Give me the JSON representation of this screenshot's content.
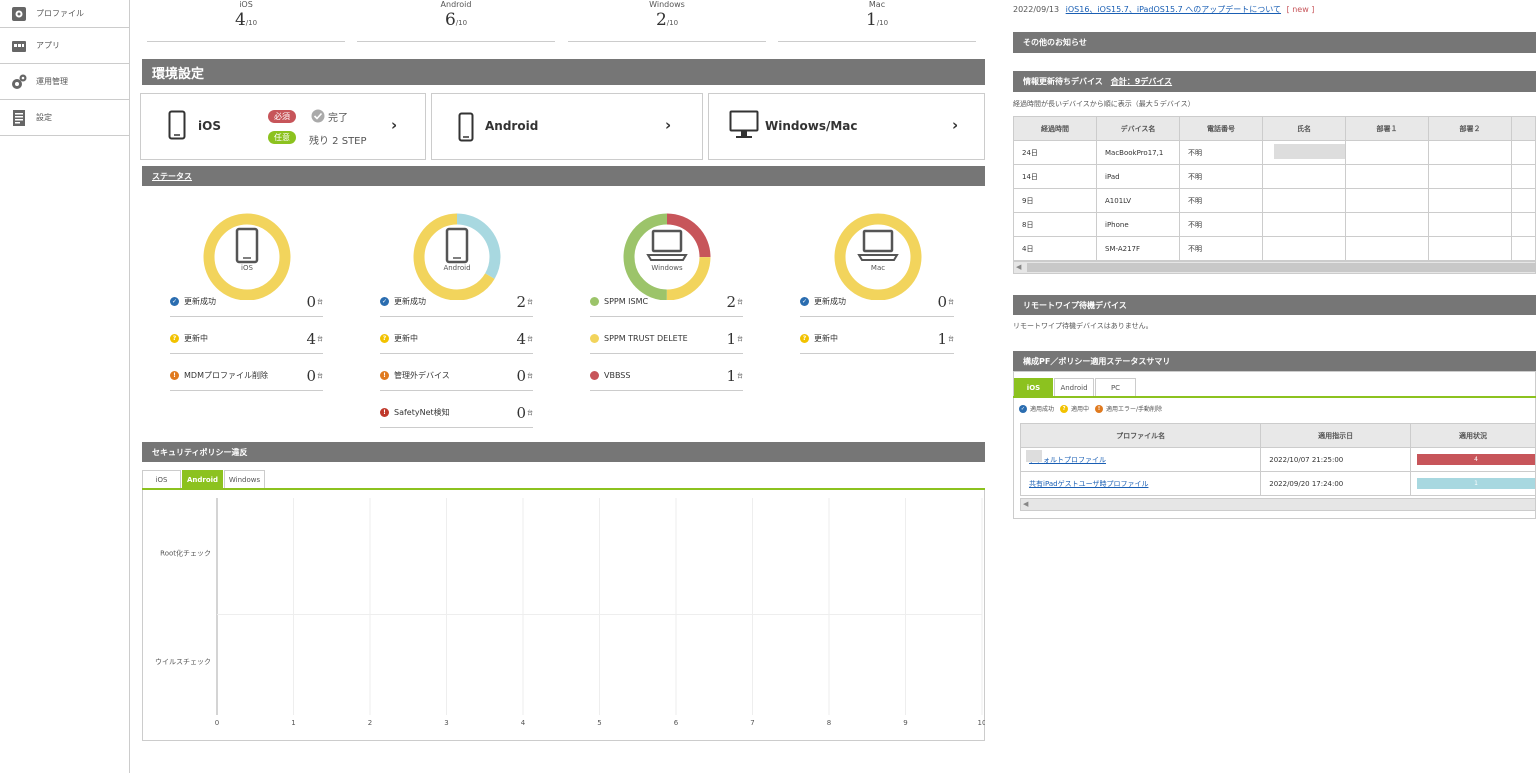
{
  "sidebar": {
    "items": [
      {
        "label": "プロファイル",
        "icon": "profile-icon"
      },
      {
        "label": "アプリ",
        "icon": "app-icon"
      },
      {
        "label": "運用管理",
        "icon": "gear-icon"
      },
      {
        "label": "設定",
        "icon": "settings-doc-icon"
      }
    ]
  },
  "counts": [
    {
      "os": "iOS",
      "value": "4",
      "denom": "/10"
    },
    {
      "os": "Android",
      "value": "6",
      "denom": "/10"
    },
    {
      "os": "Windows",
      "value": "2",
      "denom": "/10"
    },
    {
      "os": "Mac",
      "value": "1",
      "denom": "/10"
    }
  ],
  "env": {
    "title": "環境設定",
    "cards": [
      {
        "name": "iOS",
        "required": "必須",
        "done": "完了",
        "optional": "任意",
        "remaining": "残り 2 STEP"
      },
      {
        "name": "Android"
      },
      {
        "name": "Windows/Mac"
      }
    ]
  },
  "status": {
    "title": "ステータス",
    "donuts": [
      {
        "label": "iOS",
        "segments": [
          {
            "color": "#f2d45c",
            "value": 4
          }
        ]
      },
      {
        "label": "Android",
        "segments": [
          {
            "color": "#a8d8e0",
            "value": 2
          },
          {
            "color": "#f2d45c",
            "value": 4
          }
        ]
      },
      {
        "label": "Windows",
        "segments": [
          {
            "color": "#c7555a",
            "value": 1
          },
          {
            "color": "#f2d45c",
            "value": 1
          },
          {
            "color": "#9cc46a",
            "value": 2
          }
        ]
      },
      {
        "label": "Mac",
        "segments": [
          {
            "color": "#f2d45c",
            "value": 1
          }
        ]
      }
    ],
    "unit": "台",
    "columns": [
      [
        {
          "label": "更新成功",
          "value": "0",
          "icon": "check-icon",
          "color": "#2a6db0"
        },
        {
          "label": "更新中",
          "value": "4",
          "icon": "question-icon",
          "color": "#f2c200"
        },
        {
          "label": "MDMプロファイル削除",
          "value": "0",
          "icon": "alert-icon",
          "color": "#e07a1f"
        }
      ],
      [
        {
          "label": "更新成功",
          "value": "2",
          "icon": "check-icon",
          "color": "#2a6db0"
        },
        {
          "label": "更新中",
          "value": "4",
          "icon": "question-icon",
          "color": "#f2c200"
        },
        {
          "label": "管理外デバイス",
          "value": "0",
          "icon": "alert-icon",
          "color": "#e07a1f"
        },
        {
          "label": "SafetyNet検知",
          "value": "0",
          "icon": "warning-icon",
          "color": "#c0392b"
        }
      ],
      [
        {
          "label": "SPPM ISMC",
          "value": "2",
          "icon": "dot-green-icon",
          "color": "#9cc46a"
        },
        {
          "label": "SPPM TRUST DELETE",
          "value": "1",
          "icon": "dot-yellow-icon",
          "color": "#f2d45c"
        },
        {
          "label": "VBBSS",
          "value": "1",
          "icon": "dot-red-icon",
          "color": "#c7555a"
        }
      ],
      [
        {
          "label": "更新成功",
          "value": "0",
          "icon": "check-icon",
          "color": "#2a6db0"
        },
        {
          "label": "更新中",
          "value": "1",
          "icon": "question-icon",
          "color": "#f2c200"
        }
      ]
    ]
  },
  "security": {
    "title": "セキュリティポリシー違反",
    "tabs": [
      "iOS",
      "Android",
      "Windows"
    ],
    "active_tab": 1
  },
  "chart_data": {
    "type": "bar",
    "categories": [
      "Root化チェック",
      "ウイルスチェック"
    ],
    "values": [
      0,
      0
    ],
    "xlim": [
      0,
      10
    ],
    "xticks": [
      "0",
      "1",
      "2",
      "3",
      "4",
      "5",
      "6",
      "7",
      "8",
      "9",
      "10"
    ],
    "orientation": "horizontal",
    "grid": true
  },
  "news": {
    "date": "2022/09/13",
    "link": "iOS16、iOS15.7、iPadOS15.7 へのアップデートについて",
    "new_tag": "[ new ]",
    "other_title": "その他のお知らせ"
  },
  "pending": {
    "title": "情報更新待ちデバイス",
    "total": "合計：9デバイス",
    "note": "経過時間が長いデバイスから順に表示（最大５デバイス）",
    "headers": [
      "経過時間",
      "デバイス名",
      "電話番号",
      "氏名",
      "部署１",
      "部署２"
    ],
    "rows": [
      [
        "24日",
        "MacBookPro17,1",
        "不明",
        "",
        "",
        ""
      ],
      [
        "14日",
        "iPad",
        "不明",
        "",
        "",
        ""
      ],
      [
        "9日",
        "A101LV",
        "不明",
        "",
        "",
        ""
      ],
      [
        "8日",
        "iPhone",
        "不明",
        "",
        "",
        ""
      ],
      [
        "4日",
        "SM-A217F",
        "不明",
        "",
        "",
        ""
      ]
    ]
  },
  "wipe": {
    "title": "リモートワイプ待機デバイス",
    "note": "リモートワイプ待機デバイスはありません。"
  },
  "policy": {
    "title": "構成PF／ポリシー適用ステータスサマリ",
    "tabs": [
      "iOS",
      "Android",
      "PC"
    ],
    "active_tab": 0,
    "legend": [
      "適用成功",
      "適用中",
      "適用エラー/手動削除"
    ],
    "headers": [
      "プロファイル名",
      "適用指示日",
      "適用状況"
    ],
    "rows": [
      {
        "name": "デフォルトプロファイル",
        "date": "2022/10/07 21:25:00",
        "count": "4",
        "color": "#c7555a"
      },
      {
        "name": "共有iPadゲストユーザ時プロファイル",
        "date": "2022/09/20 17:24:00",
        "count": "1",
        "color": "#a8d8e0"
      }
    ]
  }
}
